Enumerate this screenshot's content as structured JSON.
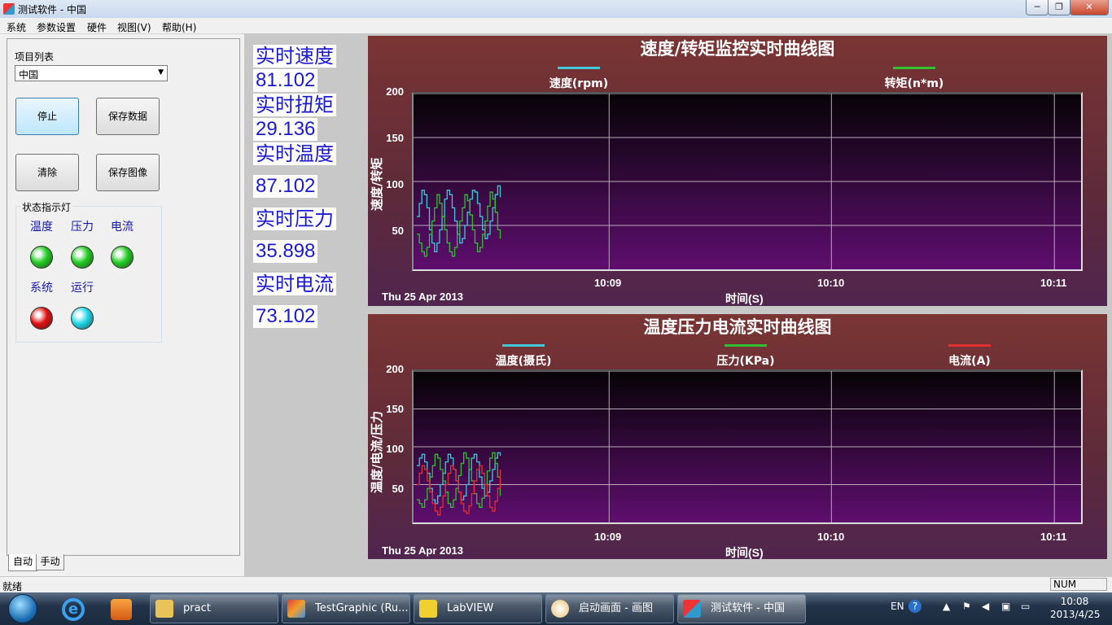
{
  "window": {
    "title": "测试软件 - 中国",
    "min": "─",
    "max": "❐",
    "close": "✕"
  },
  "menu": [
    "系统",
    "参数设置",
    "硬件",
    "视图(V)",
    "帮助(H)"
  ],
  "left": {
    "project_label": "项目列表",
    "project_value": "中国",
    "buttons": {
      "stop": "停止",
      "save_data": "保存数据",
      "clear": "清除",
      "save_image": "保存图像"
    },
    "status_group": "状态指示灯",
    "lamps": [
      {
        "label": "温度",
        "color": "#22cc22"
      },
      {
        "label": "压力",
        "color": "#22cc22"
      },
      {
        "label": "电流",
        "color": "#22cc22"
      },
      {
        "label": "系统",
        "color": "#e01010"
      },
      {
        "label": "运行",
        "color": "#20d8e8"
      }
    ],
    "tabs": [
      "自动",
      "手动"
    ]
  },
  "readings": {
    "speed_label": "实时速度",
    "speed_value": "81.102",
    "torque_label": "实时扭矩",
    "torque_value": "29.136",
    "temp_label": "实时温度",
    "temp_value": "87.102",
    "pressure_label": "实时压力",
    "pressure_value": "35.898",
    "current_label": "实时电流",
    "current_value": "73.102"
  },
  "chart_data": [
    {
      "type": "line",
      "title": "速度/转矩监控实时曲线图",
      "ylabel": "速度/转矩",
      "xlabel": "时间(S)",
      "date_label": "Thu 25 Apr 2013",
      "x_ticks": [
        "10:09",
        "10:10",
        "10:11"
      ],
      "y_ticks": [
        50,
        100,
        150,
        200
      ],
      "ylim": [
        0,
        200
      ],
      "grid": true,
      "legend_position": "top",
      "series": [
        {
          "name": "速度(rpm)",
          "color": "#40c8d8",
          "values": [
            60,
            75,
            90,
            85,
            70,
            45,
            30,
            20,
            30,
            45,
            60,
            80,
            90,
            85,
            70,
            55,
            40,
            30,
            35,
            50,
            65,
            80,
            90,
            88,
            75,
            60,
            45,
            35,
            40,
            55,
            70,
            85,
            95,
            82
          ]
        },
        {
          "name": "转矩(n*m)",
          "color": "#30c030",
          "values": [
            40,
            30,
            20,
            15,
            25,
            40,
            55,
            70,
            85,
            75,
            60,
            45,
            30,
            20,
            15,
            25,
            40,
            55,
            70,
            85,
            78,
            62,
            45,
            30,
            20,
            25,
            40,
            55,
            72,
            88,
            80,
            65,
            45,
            35
          ]
        }
      ]
    },
    {
      "type": "line",
      "title": "温度压力电流实时曲线图",
      "ylabel": "温度/电流/压力",
      "xlabel": "时间(S)",
      "date_label": "Thu 25 Apr 2013",
      "x_ticks": [
        "10:09",
        "10:10",
        "10:11"
      ],
      "y_ticks": [
        50,
        100,
        150,
        200
      ],
      "ylim": [
        0,
        200
      ],
      "grid": true,
      "legend_position": "top",
      "series": [
        {
          "name": "温度(摄氏)",
          "color": "#40c8d8",
          "values": [
            75,
            85,
            90,
            80,
            65,
            45,
            30,
            25,
            35,
            50,
            65,
            80,
            90,
            85,
            70,
            55,
            40,
            30,
            35,
            50,
            70,
            85,
            90,
            80,
            60,
            45,
            35,
            40,
            55,
            70,
            85,
            92,
            88
          ]
        },
        {
          "name": "压力(KPa)",
          "color": "#30c030",
          "values": [
            30,
            25,
            20,
            30,
            45,
            60,
            75,
            90,
            85,
            70,
            55,
            40,
            25,
            20,
            30,
            45,
            62,
            78,
            92,
            85,
            70,
            55,
            38,
            25,
            20,
            32,
            50,
            68,
            85,
            92,
            78,
            60,
            35
          ]
        },
        {
          "name": "电流(A)",
          "color": "#e03030",
          "values": [
            50,
            65,
            75,
            70,
            55,
            40,
            25,
            15,
            10,
            20,
            35,
            50,
            65,
            75,
            70,
            55,
            40,
            25,
            15,
            12,
            22,
            38,
            55,
            70,
            75,
            65,
            50,
            35,
            20,
            15,
            28,
            45,
            70
          ]
        }
      ]
    }
  ],
  "statusbar": {
    "text": "就绪",
    "num": "NUM"
  },
  "taskbar": {
    "items": [
      "pract",
      "TestGraphic (Ru...",
      "LabVIEW",
      "启动画面 - 画图",
      "测试软件 - 中国"
    ],
    "lang": "EN",
    "time": "10:08",
    "date": "2013/4/25"
  }
}
